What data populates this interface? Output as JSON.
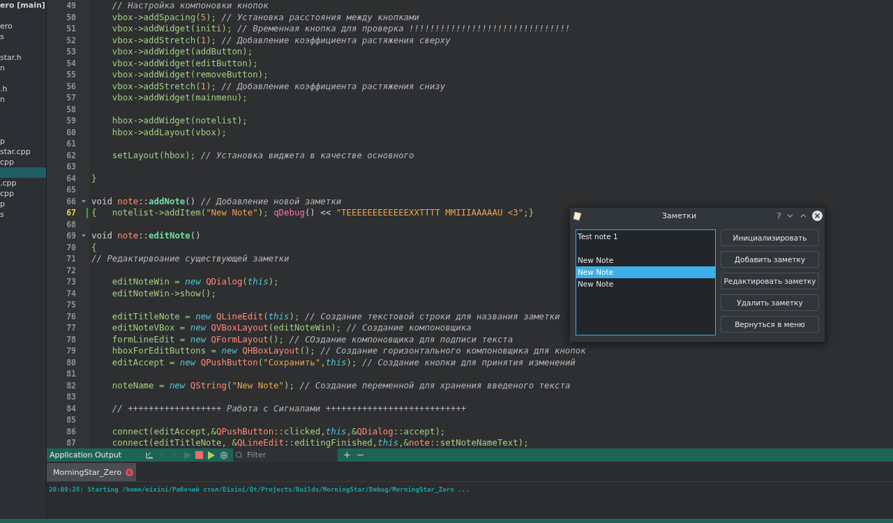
{
  "sidebar": {
    "items": [
      {
        "label": "ero [main]",
        "kind": "project",
        "selected": false
      },
      {
        "kind": "file",
        "selected": false
      },
      {
        "label": "ero",
        "kind": "file",
        "selected": false
      },
      {
        "label": "s",
        "kind": "file",
        "selected": false
      },
      {
        "kind": "file",
        "selected": false
      },
      {
        "label": "star.h",
        "kind": "file",
        "selected": false
      },
      {
        "label": "n",
        "kind": "file",
        "selected": false
      },
      {
        "kind": "file",
        "selected": false
      },
      {
        "label": ".h",
        "kind": "file",
        "selected": false
      },
      {
        "label": "n",
        "kind": "file",
        "selected": false
      },
      {
        "kind": "file",
        "selected": false
      },
      {
        "kind": "file",
        "selected": false
      },
      {
        "kind": "file",
        "selected": false
      },
      {
        "label": "p",
        "kind": "file",
        "selected": false
      },
      {
        "label": "star.cpp",
        "kind": "file",
        "selected": false
      },
      {
        "label": "cpp",
        "kind": "file",
        "selected": false
      },
      {
        "kind": "file",
        "selected": true
      },
      {
        "label": ".cpp",
        "kind": "file",
        "selected": false
      },
      {
        "label": "cpp",
        "kind": "file",
        "selected": false
      },
      {
        "label": "p",
        "kind": "file",
        "selected": false
      },
      {
        "label": "s",
        "kind": "file",
        "selected": false
      }
    ]
  },
  "editor": {
    "lines": [
      {
        "number": "49",
        "current": false,
        "foldable": false,
        "tokens": [
          {
            "kind": "comment",
            "text": "    // Настройка компоновки кнопок"
          }
        ]
      },
      {
        "number": "50",
        "current": false,
        "foldable": false,
        "tokens": [
          {
            "kind": "code",
            "text": "    vbox->addSpacing("
          },
          {
            "kind": "number",
            "text": "5"
          },
          {
            "kind": "code",
            "text": "); "
          },
          {
            "kind": "comment",
            "text": "// Установка расстояния между кнопками"
          }
        ]
      },
      {
        "number": "51",
        "current": false,
        "foldable": false,
        "tokens": [
          {
            "kind": "code",
            "text": "    vbox->addWidget(initi); "
          },
          {
            "kind": "comment",
            "text": "// Временная кнопка для проверка !!!!!!!!!!!!!!!!!!!!!!!!!!!!!!!"
          }
        ]
      },
      {
        "number": "52",
        "current": false,
        "foldable": false,
        "tokens": [
          {
            "kind": "code",
            "text": "    vbox->addStretch("
          },
          {
            "kind": "number",
            "text": "1"
          },
          {
            "kind": "code",
            "text": "); "
          },
          {
            "kind": "comment",
            "text": "// Добавление коэффициента растяжения сверху"
          }
        ]
      },
      {
        "number": "53",
        "current": false,
        "foldable": false,
        "tokens": [
          {
            "kind": "code",
            "text": "    vbox->addWidget(addButton);"
          }
        ]
      },
      {
        "number": "54",
        "current": false,
        "foldable": false,
        "tokens": [
          {
            "kind": "code",
            "text": "    vbox->addWidget(editButton);"
          }
        ]
      },
      {
        "number": "55",
        "current": false,
        "foldable": false,
        "tokens": [
          {
            "kind": "code",
            "text": "    vbox->addWidget(removeButton);"
          }
        ]
      },
      {
        "number": "56",
        "current": false,
        "foldable": false,
        "tokens": [
          {
            "kind": "code",
            "text": "    vbox->addStretch("
          },
          {
            "kind": "number",
            "text": "1"
          },
          {
            "kind": "code",
            "text": "); "
          },
          {
            "kind": "comment",
            "text": "// Добавление коэффициента растяжения снизу"
          }
        ]
      },
      {
        "number": "57",
        "current": false,
        "foldable": false,
        "tokens": [
          {
            "kind": "code",
            "text": "    vbox->addWidget(mainmenu);"
          }
        ]
      },
      {
        "number": "58",
        "current": false,
        "foldable": false
      },
      {
        "number": "59",
        "current": false,
        "foldable": false,
        "tokens": [
          {
            "kind": "code",
            "text": "    hbox->addWidget(notelist);"
          }
        ]
      },
      {
        "number": "60",
        "current": false,
        "foldable": false,
        "tokens": [
          {
            "kind": "code",
            "text": "    hbox->addLayout(vbox);"
          }
        ]
      },
      {
        "number": "61",
        "current": false,
        "foldable": false
      },
      {
        "number": "62",
        "current": false,
        "foldable": false,
        "tokens": [
          {
            "kind": "code",
            "text": "    setLayout(hbox); "
          },
          {
            "kind": "comment",
            "text": "// Установка виджета в качестве основного"
          }
        ]
      },
      {
        "number": "63",
        "current": false,
        "foldable": false
      },
      {
        "number": "64",
        "current": false,
        "foldable": false,
        "tokens": [
          {
            "kind": "code",
            "text": "}"
          }
        ]
      },
      {
        "number": "65",
        "current": false,
        "foldable": false
      },
      {
        "number": "66",
        "current": false,
        "foldable": true,
        "tokens": [
          {
            "kind": "plain",
            "text": "void "
          },
          {
            "kind": "type",
            "text": "note"
          },
          {
            "kind": "plain",
            "text": "::"
          },
          {
            "kind": "function",
            "text": "addNote"
          },
          {
            "kind": "plain",
            "text": "() "
          },
          {
            "kind": "comment",
            "text": "// Добавление новой заметки"
          }
        ]
      },
      {
        "number": "67",
        "current": true,
        "foldable": false,
        "tokens": [
          {
            "kind": "code",
            "text": "{   notelist->addItem("
          },
          {
            "kind": "string",
            "text": "\"New Note\""
          },
          {
            "kind": "code",
            "text": "); "
          },
          {
            "kind": "macro",
            "text": "qDebug"
          },
          {
            "kind": "plain",
            "text": "() << "
          },
          {
            "kind": "string",
            "text": "\"TEEEEEEEEEEEEXXTTTT MMIIIAAAAAU <3\""
          },
          {
            "kind": "code",
            "text": ";}"
          }
        ]
      },
      {
        "number": "68",
        "current": false,
        "foldable": false
      },
      {
        "number": "69",
        "current": false,
        "foldable": true,
        "tokens": [
          {
            "kind": "plain",
            "text": "void "
          },
          {
            "kind": "type",
            "text": "note"
          },
          {
            "kind": "plain",
            "text": "::"
          },
          {
            "kind": "function",
            "text": "editNote"
          },
          {
            "kind": "plain",
            "text": "()"
          }
        ]
      },
      {
        "number": "70",
        "current": false,
        "foldable": false,
        "tokens": [
          {
            "kind": "code",
            "text": "{"
          }
        ]
      },
      {
        "number": "71",
        "current": false,
        "foldable": false,
        "tokens": [
          {
            "kind": "comment",
            "text": "// Редактирвоание существующей заметки"
          }
        ]
      },
      {
        "number": "72",
        "current": false,
        "foldable": false
      },
      {
        "number": "73",
        "current": false,
        "foldable": false,
        "tokens": [
          {
            "kind": "code",
            "text": "    editNoteWin = "
          },
          {
            "kind": "keyword",
            "text": "new "
          },
          {
            "kind": "type",
            "text": "QDialog"
          },
          {
            "kind": "code",
            "text": "("
          },
          {
            "kind": "keyword",
            "text": "this"
          },
          {
            "kind": "code",
            "text": ");"
          }
        ]
      },
      {
        "number": "74",
        "current": false,
        "foldable": false,
        "tokens": [
          {
            "kind": "code",
            "text": "    editNoteWin->show();"
          }
        ]
      },
      {
        "number": "75",
        "current": false,
        "foldable": false
      },
      {
        "number": "76",
        "current": false,
        "foldable": false,
        "tokens": [
          {
            "kind": "code",
            "text": "    editTitleNote = "
          },
          {
            "kind": "keyword",
            "text": "new "
          },
          {
            "kind": "type",
            "text": "QLineEdit"
          },
          {
            "kind": "code",
            "text": "("
          },
          {
            "kind": "keyword",
            "text": "this"
          },
          {
            "kind": "code",
            "text": "); "
          },
          {
            "kind": "comment",
            "text": "// Создание текстовой строки для названия заметки"
          }
        ]
      },
      {
        "number": "77",
        "current": false,
        "foldable": false,
        "tokens": [
          {
            "kind": "code",
            "text": "    editNoteVBox = "
          },
          {
            "kind": "keyword",
            "text": "new "
          },
          {
            "kind": "type",
            "text": "QVBoxLayout"
          },
          {
            "kind": "code",
            "text": "(editNoteWin); "
          },
          {
            "kind": "comment",
            "text": "// Создание компоновщика"
          }
        ]
      },
      {
        "number": "78",
        "current": false,
        "foldable": false,
        "tokens": [
          {
            "kind": "code",
            "text": "    formLineEdit = "
          },
          {
            "kind": "keyword",
            "text": "new "
          },
          {
            "kind": "type",
            "text": "QFormLayout"
          },
          {
            "kind": "code",
            "text": "(); "
          },
          {
            "kind": "comment",
            "text": "// СОздание компоновщика для подписи текста"
          }
        ]
      },
      {
        "number": "79",
        "current": false,
        "foldable": false,
        "tokens": [
          {
            "kind": "code",
            "text": "    hboxForEditButtons = "
          },
          {
            "kind": "keyword",
            "text": "new "
          },
          {
            "kind": "type",
            "text": "QHBoxLayout"
          },
          {
            "kind": "code",
            "text": "(); "
          },
          {
            "kind": "comment",
            "text": "// Создание горизонтального компоновщика для кнопок"
          }
        ]
      },
      {
        "number": "80",
        "current": false,
        "foldable": false,
        "tokens": [
          {
            "kind": "code",
            "text": "    editAccept = "
          },
          {
            "kind": "keyword",
            "text": "new "
          },
          {
            "kind": "type",
            "text": "QPushButton"
          },
          {
            "kind": "code",
            "text": "("
          },
          {
            "kind": "string",
            "text": "\"Сохранить\""
          },
          {
            "kind": "code",
            "text": ","
          },
          {
            "kind": "keyword",
            "text": "this"
          },
          {
            "kind": "code",
            "text": "); "
          },
          {
            "kind": "comment",
            "text": "// Создание кнопки для принятия изменений"
          }
        ]
      },
      {
        "number": "81",
        "current": false,
        "foldable": false
      },
      {
        "number": "82",
        "current": false,
        "foldable": false,
        "tokens": [
          {
            "kind": "code",
            "text": "    noteName = "
          },
          {
            "kind": "keyword",
            "text": "new "
          },
          {
            "kind": "type",
            "text": "QString"
          },
          {
            "kind": "code",
            "text": "("
          },
          {
            "kind": "string",
            "text": "\"New Note\""
          },
          {
            "kind": "code",
            "text": "); "
          },
          {
            "kind": "comment",
            "text": "// Создание переменной для хранения введеного текста"
          }
        ]
      },
      {
        "number": "83",
        "current": false,
        "foldable": false
      },
      {
        "number": "84",
        "current": false,
        "foldable": false,
        "tokens": [
          {
            "kind": "comment",
            "text": "    // ++++++++++++++++++ Работа с Сигналами +++++++++++++++++++++++++++"
          }
        ]
      },
      {
        "number": "85",
        "current": false,
        "foldable": false
      },
      {
        "number": "86",
        "current": false,
        "foldable": false,
        "tokens": [
          {
            "kind": "code",
            "text": "    connect(editAccept,&"
          },
          {
            "kind": "type",
            "text": "QPushButton"
          },
          {
            "kind": "code",
            "text": "::clicked,"
          },
          {
            "kind": "keyword",
            "text": "this"
          },
          {
            "kind": "code",
            "text": ",&"
          },
          {
            "kind": "type",
            "text": "QDialog"
          },
          {
            "kind": "code",
            "text": "::accept);"
          }
        ]
      },
      {
        "number": "87",
        "current": false,
        "foldable": false,
        "tokens": [
          {
            "kind": "code",
            "text": "    connect(editTitleNote, &"
          },
          {
            "kind": "type",
            "text": "QLineEdit"
          },
          {
            "kind": "code",
            "text": "::editingFinished,"
          },
          {
            "kind": "keyword",
            "text": "this"
          },
          {
            "kind": "code",
            "text": ",&"
          },
          {
            "kind": "type",
            "text": "note"
          },
          {
            "kind": "code",
            "text": "::setNoteNameText);"
          }
        ]
      }
    ]
  },
  "dialog": {
    "title": "Заметки",
    "title_buttons": [
      "?"
    ],
    "list": [
      {
        "label": "Test note 1",
        "selected": false
      },
      {
        "selected": false
      },
      {
        "label": "New Note",
        "selected": false
      },
      {
        "label": "New Note",
        "selected": true
      },
      {
        "label": "New Note",
        "selected": false
      }
    ],
    "buttons": [
      "Инициализировать",
      "Добавить заметку",
      "Редактировать заметку",
      "Удалить заметку",
      "Вернуться в меню"
    ]
  },
  "output": {
    "title": "Application Output",
    "filter": {
      "placeholder": "Filter"
    },
    "tab": {
      "label": "MorningStar_Zero"
    },
    "text": "20:09:28: Starting /home/eixini/Рабочий стол/Eixini/Qt/Projects/Builds/MorningStar/Debug/MorningStar_Zero ..."
  }
}
